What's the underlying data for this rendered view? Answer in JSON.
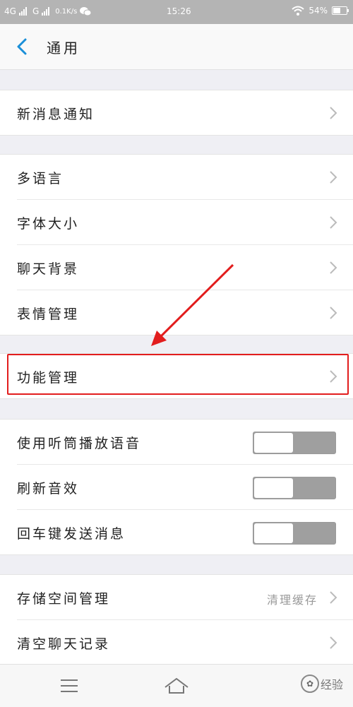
{
  "status_bar": {
    "network1": "4G",
    "network2": "G",
    "speed": "0.1K/s",
    "time": "15:26",
    "battery": "54%",
    "battery_level": 0.54
  },
  "header": {
    "title": "通用"
  },
  "groups": [
    {
      "rows": [
        {
          "label": "新消息通知"
        }
      ]
    },
    {
      "rows": [
        {
          "label": "多语言"
        },
        {
          "label": "字体大小"
        },
        {
          "label": "聊天背景"
        },
        {
          "label": "表情管理"
        }
      ]
    },
    {
      "rows": [
        {
          "label": "功能管理"
        }
      ]
    },
    {
      "rows": [
        {
          "label": "使用听筒播放语音"
        },
        {
          "label": "刷新音效"
        },
        {
          "label": "回车键发送消息"
        }
      ]
    },
    {
      "rows": [
        {
          "label": "存储空间管理",
          "value": "清理缓存"
        },
        {
          "label": "清空聊天记录"
        }
      ]
    }
  ],
  "colors": {
    "highlight": "#e21d1d",
    "accent": "#1a8fd8",
    "toggle_off": "#9f9f9f"
  },
  "watermark": {
    "text": "经验"
  }
}
